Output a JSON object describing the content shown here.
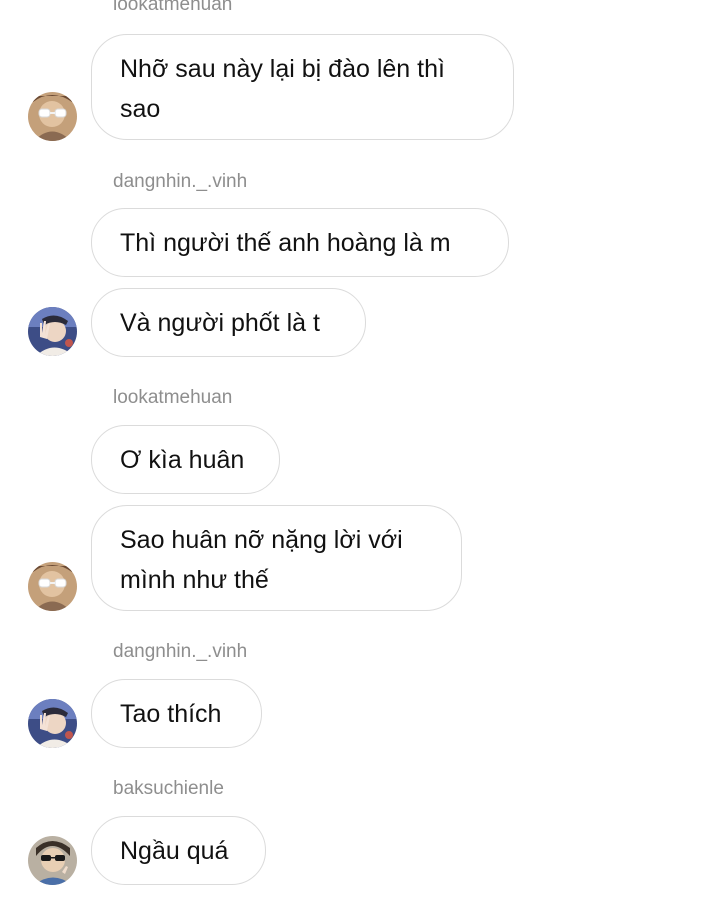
{
  "messages": [
    {
      "sender": "lookatmehuan",
      "text": "Nhỡ sau này lại bị đào lên thì sao"
    },
    {
      "sender": "dangnhin._.vinh",
      "text": "Thì người thế anh hoàng là m"
    },
    {
      "text": "Và người phốt là t"
    },
    {
      "sender": "lookatmehuan",
      "text": "Ơ kìa huân"
    },
    {
      "text": "Sao huân nỡ nặng lời với mình như thế"
    },
    {
      "sender": "dangnhin._.vinh",
      "text": "Tao thích"
    },
    {
      "sender": "baksuchienle",
      "text": "Ngầu quá"
    }
  ],
  "avatars": {
    "lookatmehuan": "avatar-white-sunglasses",
    "dangnhin._.vinh": "avatar-hand-pose",
    "baksuchienle": "avatar-dark-sunglasses"
  },
  "colors": {
    "sender_text": "#8e8e8e",
    "bubble_border": "#dbdbdb",
    "message_text": "#111111",
    "background": "#ffffff"
  }
}
